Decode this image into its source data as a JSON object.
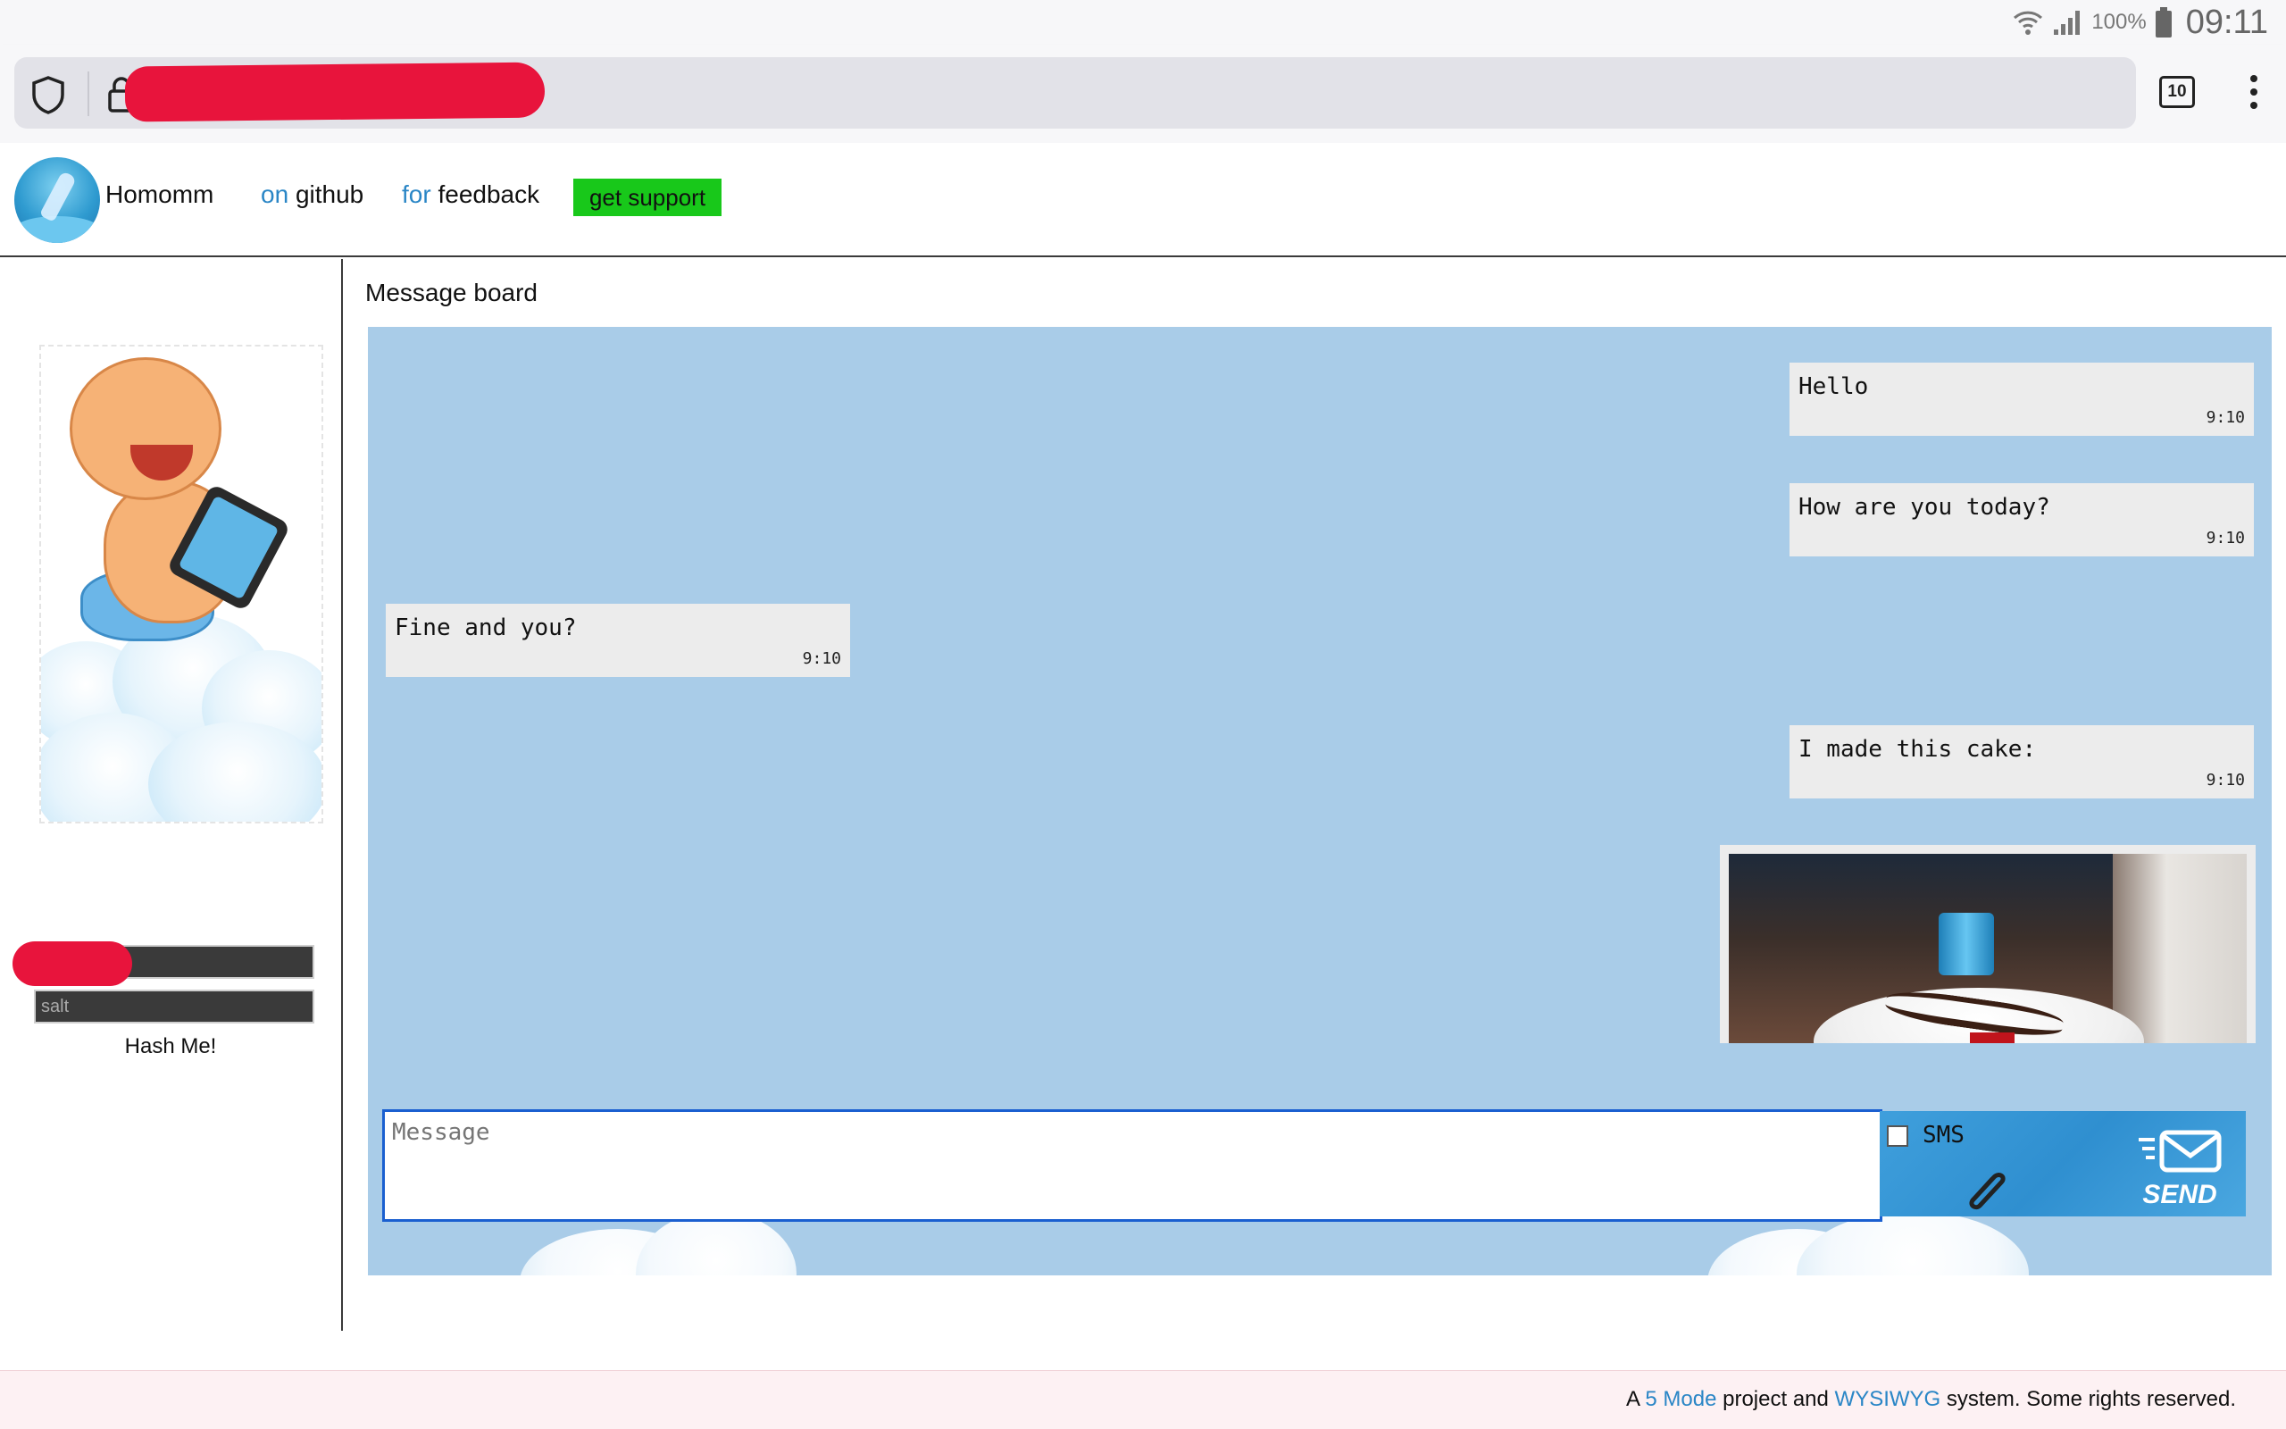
{
  "status_bar": {
    "battery": "100%",
    "time": "09:11",
    "icons": [
      "wifi-icon",
      "signal-icon",
      "battery-icon"
    ]
  },
  "browser": {
    "tab_count": "10",
    "icons": [
      "shield-icon",
      "lock-icon",
      "kebab-menu-icon"
    ]
  },
  "header": {
    "brand": "Homomm",
    "nav_github_prefix": "on",
    "nav_github_label": "github",
    "nav_feedback_prefix": "for",
    "nav_feedback_label": "feedback",
    "support_label": "get support",
    "support_color": "#18c81a",
    "link_color": "#2a86c6"
  },
  "sidebar": {
    "salt_placeholder": "salt",
    "hash_button": "Hash Me!"
  },
  "board": {
    "title": "Message board",
    "background_color": "#a9cce8",
    "messages": [
      {
        "text": "Hello",
        "time": "9:10",
        "side": "right"
      },
      {
        "text": "How are you today?",
        "time": "9:10",
        "side": "right"
      },
      {
        "text": "Fine and you?",
        "time": "9:10",
        "side": "left"
      },
      {
        "text": "I made this cake:",
        "time": "9:10",
        "side": "right"
      }
    ],
    "image_message": {
      "side": "right",
      "content": "cake-photo"
    }
  },
  "composer": {
    "placeholder": "Message",
    "sms_label": "SMS",
    "sms_checked": false,
    "send_label": "SEND",
    "icons": [
      "paperclip-icon",
      "send-envelope-icon"
    ]
  },
  "footer": {
    "prefix": "A ",
    "link1": "5 Mode",
    "middle": " project and ",
    "link2": "WYSIWYG",
    "suffix": " system. Some rights reserved."
  }
}
